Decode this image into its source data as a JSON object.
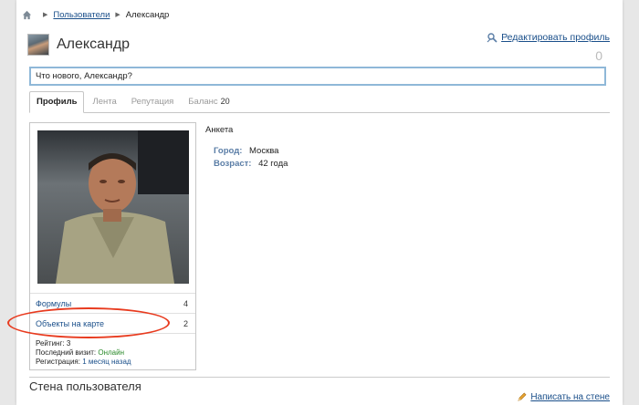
{
  "breadcrumb": {
    "home_icon": "home-icon",
    "items": [
      "Пользователи",
      "Александр"
    ]
  },
  "header": {
    "name": "Александр",
    "edit_profile": "Редактировать профиль",
    "counter": "0"
  },
  "status": {
    "value": "Что нового, Александр?"
  },
  "tabs": [
    {
      "label": "Профиль",
      "active": true
    },
    {
      "label": "Лента"
    },
    {
      "label": "Репутация"
    },
    {
      "label": "Баланс",
      "count": "20"
    }
  ],
  "sidebar": {
    "items": [
      {
        "label": "Формулы",
        "count": "4"
      },
      {
        "label": "Объекты на карте",
        "count": "2"
      }
    ],
    "stats": {
      "rating_label": "Рейтинг:",
      "rating_value": "3",
      "last_visit_label": "Последний визит:",
      "last_visit_value": "Онлайн",
      "registration_label": "Регистрация:",
      "registration_value": "1 месяц назад"
    }
  },
  "profile": {
    "section_title": "Анкета",
    "fields": [
      {
        "key": "Город:",
        "value": "Москва"
      },
      {
        "key": "Возраст:",
        "value": "42 года"
      }
    ]
  },
  "wall": {
    "title": "Стена пользователя",
    "write_link": "Написать на стене"
  },
  "colors": {
    "link": "#1a4f8a",
    "online": "#2a8a2a",
    "annotation": "#e83b1f",
    "input_border": "#8fb8d8"
  }
}
